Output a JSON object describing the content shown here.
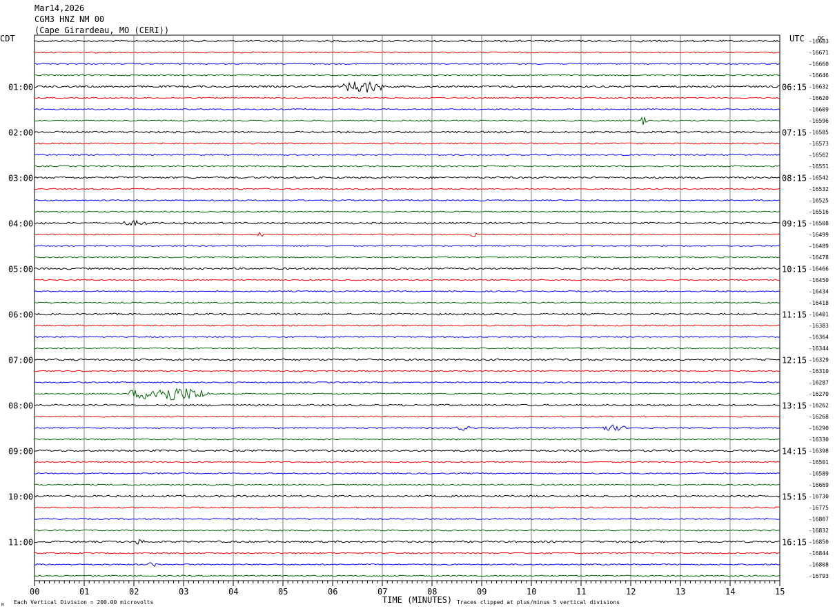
{
  "header": {
    "date": "Mar14,2026",
    "station": "CGM3 HNZ NM 00",
    "location": "(Cape Girardeau, MO (CERI))"
  },
  "left_tz": "CDT",
  "right_tz": "UTC",
  "dc_label": "DC",
  "footer": {
    "scale_note": "Each Vertical Division =  200.00 microvolts",
    "clip_note": "Traces clipped at plus/minus 5 vertical divisions",
    "corner_mark": "M"
  },
  "colors": {
    "black": "#000000",
    "red": "#ff0000",
    "blue": "#0000ff",
    "green": "#006400",
    "grid": "#808080"
  },
  "chart_data": {
    "type": "line",
    "title": "",
    "xlabel": "TIME (MINUTES)",
    "ylabel": "",
    "xlim": [
      0,
      15
    ],
    "x_ticks": [
      "00",
      "01",
      "02",
      "03",
      "04",
      "05",
      "06",
      "07",
      "08",
      "09",
      "10",
      "11",
      "12",
      "13",
      "14",
      "15"
    ],
    "trace_color_cycle": [
      "black",
      "red",
      "blue",
      "green"
    ],
    "hour_labels_left": [
      "01:00",
      "02:00",
      "03:00",
      "04:00",
      "05:00",
      "06:00",
      "07:00",
      "08:00",
      "09:00",
      "10:00",
      "11:00"
    ],
    "hour_labels_right": [
      "06:15",
      "07:15",
      "08:15",
      "09:15",
      "10:15",
      "11:15",
      "12:15",
      "13:15",
      "14:15",
      "15:15",
      "16:15"
    ],
    "hour_label_trace_index": [
      4,
      8,
      12,
      16,
      20,
      24,
      28,
      32,
      36,
      40,
      44
    ],
    "dc_offsets": [
      "-16683",
      "-16671",
      "-16660",
      "-16646",
      "-16632",
      "-16620",
      "-16609",
      "-16596",
      "-16585",
      "-16573",
      "-16562",
      "-16551",
      "-16542",
      "-16532",
      "-16525",
      "-16516",
      "-16508",
      "-16499",
      "-16489",
      "-16478",
      "-16466",
      "-16450",
      "-16434",
      "-16418",
      "-16401",
      "-16383",
      "-16364",
      "-16344",
      "-16329",
      "-16310",
      "-16287",
      "-16270",
      "-16262",
      "-16268",
      "-16290",
      "-16330",
      "-16398",
      "-16501",
      "-16589",
      "-16669",
      "-16730",
      "-16775",
      "-16807",
      "-16832",
      "-16850",
      "-16844",
      "-16808",
      "-16793"
    ],
    "events": [
      {
        "trace": 4,
        "start_min": 6.2,
        "end_min": 7.0,
        "amplitude": 0.9
      },
      {
        "trace": 7,
        "start_min": 12.2,
        "end_min": 12.35,
        "amplitude": 0.7
      },
      {
        "trace": 16,
        "start_min": 1.7,
        "end_min": 2.3,
        "amplitude": 0.25
      },
      {
        "trace": 17,
        "start_min": 4.5,
        "end_min": 4.6,
        "amplitude": 0.6
      },
      {
        "trace": 17,
        "start_min": 8.8,
        "end_min": 8.9,
        "amplitude": 0.4
      },
      {
        "trace": 31,
        "start_min": 1.9,
        "end_min": 3.5,
        "amplitude": 1.1
      },
      {
        "trace": 34,
        "start_min": 8.5,
        "end_min": 8.8,
        "amplitude": 0.3
      },
      {
        "trace": 34,
        "start_min": 11.3,
        "end_min": 11.9,
        "amplitude": 0.4
      },
      {
        "trace": 44,
        "start_min": 2.0,
        "end_min": 2.2,
        "amplitude": 0.3
      },
      {
        "trace": 46,
        "start_min": 2.3,
        "end_min": 2.45,
        "amplitude": 0.4
      }
    ]
  }
}
